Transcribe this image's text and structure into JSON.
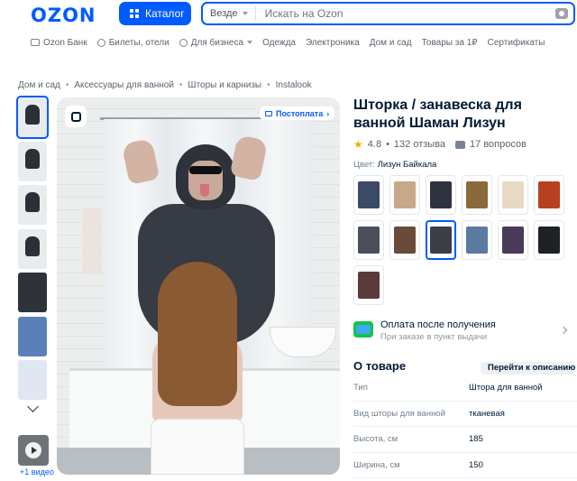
{
  "header": {
    "logo": "OZON",
    "catalog_label": "Каталог",
    "search_scope": "Везде",
    "search_placeholder": "Искать на Ozon"
  },
  "nav": {
    "items": [
      "Ozon Банк",
      "Билеты, отели",
      "Для бизнеса",
      "Одежда",
      "Электроника",
      "Дом и сад",
      "Товары за 1₽",
      "Сертификаты"
    ]
  },
  "breadcrumbs": [
    "Дом и сад",
    "Аксессуары для ванной",
    "Шторы и карнизы",
    "Instalook"
  ],
  "gallery": {
    "video_label": "+1 видео",
    "postpay_label": "Постоплата"
  },
  "product": {
    "title": "Шторка / занавеска для ванной Шаман Лизун",
    "rating": "4.8",
    "reviews": "132 отзыва",
    "questions": "17 вопросов",
    "color_label": "Цвет:",
    "color_value": "Лизун Байкала"
  },
  "swatch_colors": [
    "#3b4a66",
    "#c9a88a",
    "#2f3340",
    "#8a6a3a",
    "#e8d9c5",
    "#b8401e",
    "#4a4f5a",
    "#6b4a3a",
    "#3a3f48",
    "#5a7aa0",
    "#4a3a5a",
    "#1e2126",
    "#5a3a3a"
  ],
  "payment": {
    "title": "Оплата после получения",
    "subtitle": "При заказе в пункт выдачи"
  },
  "about": {
    "title": "О товаре",
    "link": "Перейти к описанию",
    "specs": [
      {
        "key": "Тип",
        "value": "Штора для ванной"
      },
      {
        "key": "Вид шторы для ванной",
        "value": "тканевая"
      },
      {
        "key": "Высота, см",
        "value": "185"
      },
      {
        "key": "Ширина, см",
        "value": "150"
      }
    ]
  },
  "colors": {
    "brand": "#005bff",
    "text": "#001a34",
    "muted": "#707f8d",
    "star": "#ffa800"
  }
}
